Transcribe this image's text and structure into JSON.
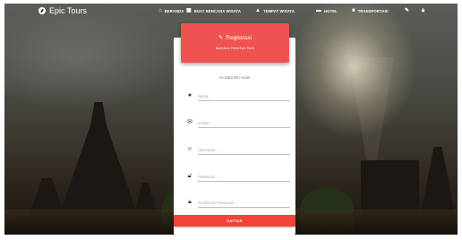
{
  "navbar": {
    "brand": "Epic Tours",
    "items": [
      {
        "icon": "home-icon",
        "label": "BERANDA"
      },
      {
        "icon": "calendar-icon",
        "label": "BUAT RENCANA WISATA"
      },
      {
        "icon": "landscape-icon",
        "label": "TEMPAT WISATA"
      },
      {
        "icon": "bed-icon",
        "label": "HOTEL"
      },
      {
        "icon": "bus-icon",
        "label": "TRANSPORTASI"
      },
      {
        "icon": "pencil-icon",
        "label": ""
      },
      {
        "icon": "lock-icon",
        "label": ""
      }
    ]
  },
  "header": {
    "title": "Registrasi",
    "subtitle": "Buat Akun Pada Epic Tours"
  },
  "form": {
    "caption": "Isi Data Diri Anda",
    "fields": [
      {
        "icon": "user-icon",
        "placeholder": "Nama..."
      },
      {
        "icon": "email-icon",
        "placeholder": "E-Mail..."
      },
      {
        "icon": "face-icon",
        "placeholder": "Username..."
      },
      {
        "icon": "lock-open-icon",
        "placeholder": "Password..."
      },
      {
        "icon": "lock-icon",
        "placeholder": "Konfirmasi Password..."
      }
    ],
    "submit_label": "DAFTAR"
  },
  "colors": {
    "accent": "#ef5350",
    "button": "#f44336"
  }
}
